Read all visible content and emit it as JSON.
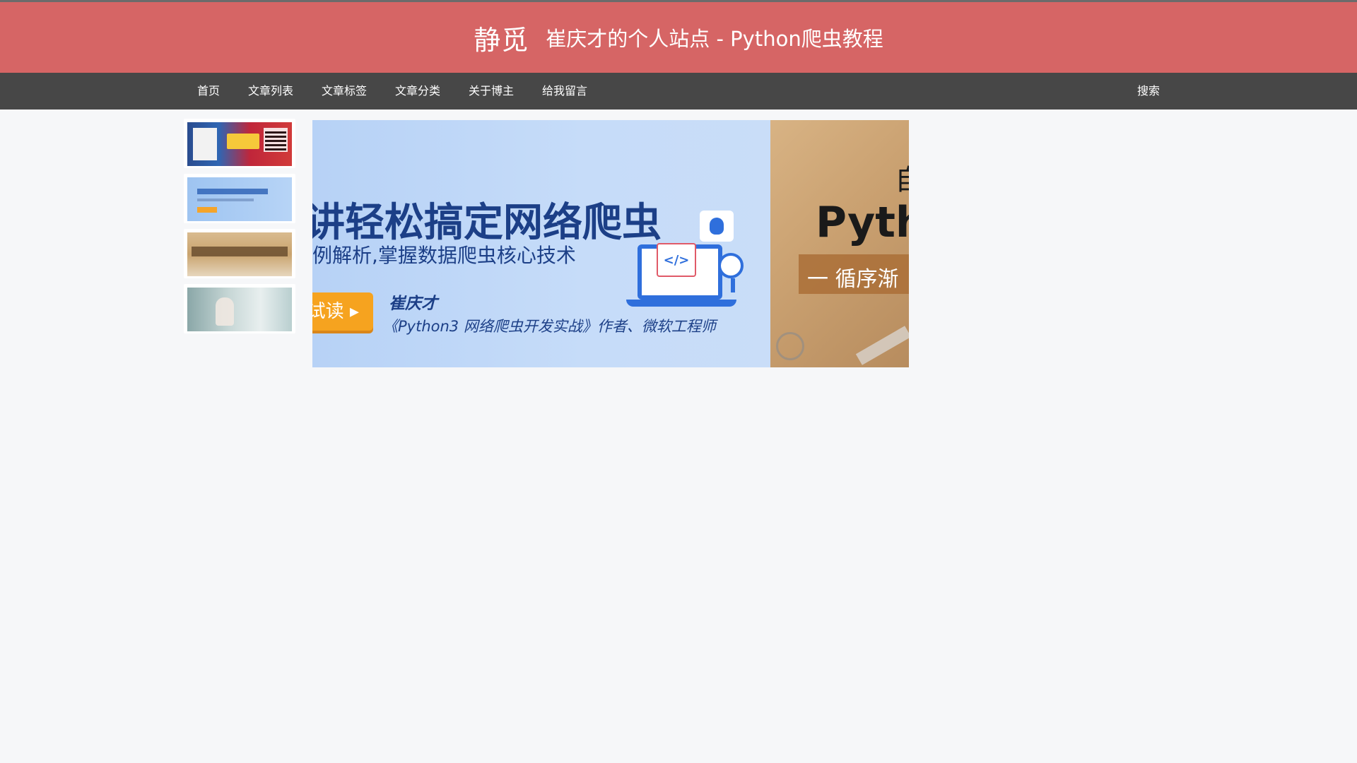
{
  "header": {
    "site_name": "静觅",
    "subtitle": "崔庆才的个人站点 - Python爬虫教程",
    "bg_color": "#d66565"
  },
  "nav": {
    "items": [
      {
        "label": "首页"
      },
      {
        "label": "文章列表"
      },
      {
        "label": "文章标签"
      },
      {
        "label": "文章分类"
      },
      {
        "label": "关于博主"
      },
      {
        "label": "给我留言"
      }
    ],
    "search_label": "搜索",
    "bg_color": "#474747"
  },
  "banner": {
    "title": "讲轻松搞定网络爬虫",
    "subtitle": "例解析,掌握数据爬虫核心技术",
    "button_label": "试读 ▸",
    "author": "崔庆才",
    "author_desc": "《Python3 网络爬虫开发实战》作者、微软工程师",
    "side_top": "自",
    "side_text": "Pyth",
    "side_band": "一 循序渐"
  }
}
